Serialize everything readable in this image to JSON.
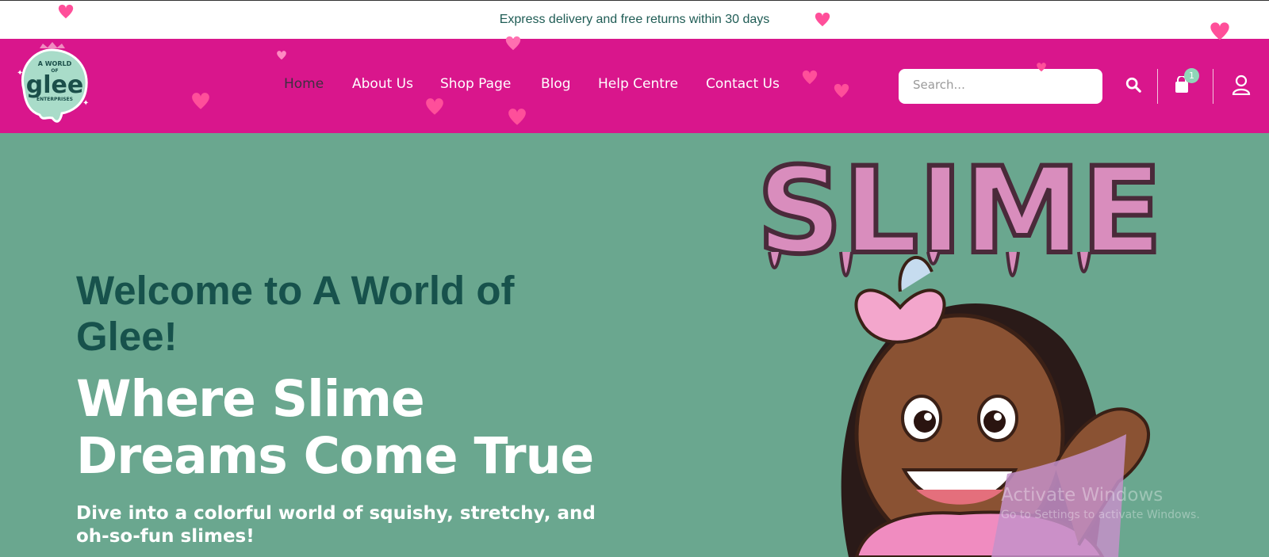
{
  "announcement": "Express delivery and free returns within 30 days",
  "logo": {
    "line1": "A WORLD",
    "line2": "OF",
    "brand": "glee",
    "line3": "ENTERPRISES"
  },
  "nav": {
    "items": [
      "Home",
      "About Us",
      "Shop Page",
      "Blog",
      "Help Centre",
      "Contact Us"
    ],
    "active": "Home"
  },
  "search": {
    "placeholder": "Search..."
  },
  "cart": {
    "count": "1"
  },
  "hero": {
    "welcome": "Welcome to A World of Glee!",
    "tagline_line1": "Where Slime",
    "tagline_line2": "Dreams Come True",
    "description": "Dive into a colorful world of squishy, stretchy, and oh-so-fun slimes!",
    "art_title": "SLIME"
  },
  "watermark": {
    "line1": "Activate Windows",
    "line2": "Go to Settings to activate Windows."
  },
  "icons": [
    "search-icon",
    "cart-icon",
    "user-icon",
    "heart-icon"
  ],
  "colors": {
    "header": "#d9168c",
    "hero_bg": "#6aa78f",
    "welcome_text": "#17524c",
    "topbar_text": "#1f5c55",
    "badge": "#8fd6b8"
  }
}
